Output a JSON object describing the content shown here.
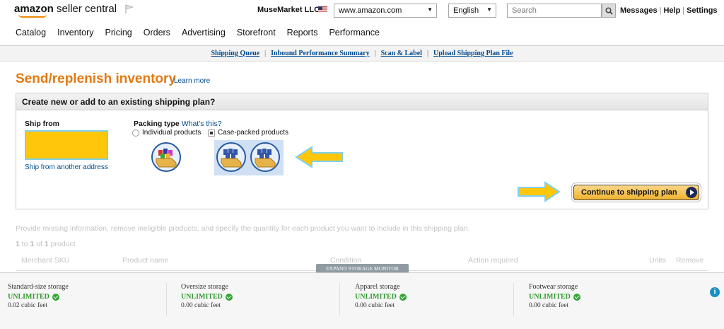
{
  "header": {
    "logo_brand": "amazon",
    "logo_product": "seller central",
    "merchant_name": "MuseMarket LLC",
    "marketplace": "www.amazon.com",
    "language": "English",
    "search_placeholder": "Search",
    "links": [
      "Messages",
      "Help",
      "Settings"
    ]
  },
  "nav": [
    "Catalog",
    "Inventory",
    "Pricing",
    "Orders",
    "Advertising",
    "Storefront",
    "Reports",
    "Performance"
  ],
  "subnav": [
    "Shipping Queue",
    "Inbound Performance Summary",
    "Scan & Label",
    "Upload Shipping Plan File"
  ],
  "page": {
    "title": "Send/replenish inventory",
    "learn_more": "Learn more"
  },
  "plan": {
    "heading": "Create new or add to an existing shipping plan?",
    "ship_from_label": "Ship from",
    "ship_other": "Ship from another address",
    "packing_label": "Packing type",
    "whats_this": "What's this?",
    "option_individual": "Individual products",
    "option_case": "Case-packed products",
    "selected_option": "Case-packed products",
    "continue_label": "Continue to shipping plan"
  },
  "details": {
    "instruction": "Provide missing information, remove ineligible products, and specify the quantity for each product you want to include in this shipping plan.",
    "range_start": "1",
    "range_mid": "to",
    "range_end": "1",
    "range_of": "of",
    "range_total": "1",
    "range_unit": "product",
    "columns": [
      "Merchant SKU",
      "Product name",
      "Condition",
      "Action required",
      "Units",
      "Remove"
    ]
  },
  "storage_monitor": {
    "tab_label": "EXPAND STORAGE MONITOR",
    "items": [
      {
        "label": "Standard-size storage",
        "status": "UNLIMITED",
        "amount": "0.02 cubic feet"
      },
      {
        "label": "Oversize storage",
        "status": "UNLIMITED",
        "amount": "0.00 cubic feet"
      },
      {
        "label": "Apparel storage",
        "status": "UNLIMITED",
        "amount": "0.00 cubic feet"
      },
      {
        "label": "Footwear storage",
        "status": "UNLIMITED",
        "amount": "0.00 cubic feet"
      }
    ]
  },
  "colors": {
    "title_orange": "#e47911",
    "link_blue": "#004b91",
    "highlight_yellow": "#ffc60a",
    "status_green": "#2e9a2e"
  }
}
